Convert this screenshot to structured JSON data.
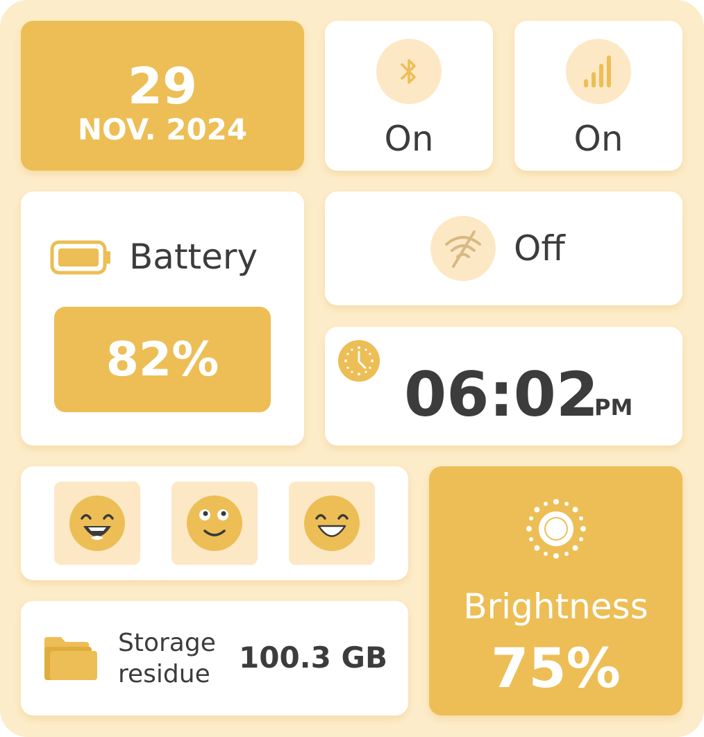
{
  "date": {
    "day": "29",
    "month_year": "NOV. 2024"
  },
  "bluetooth": {
    "icon": "bluetooth-icon",
    "status": "On"
  },
  "signal": {
    "icon": "signal-bars-icon",
    "status": "On"
  },
  "battery": {
    "icon": "battery-icon",
    "label": "Battery",
    "percent": "82%"
  },
  "wifi": {
    "icon": "wifi-off-icon",
    "status": "Off"
  },
  "clock": {
    "icon": "clock-icon",
    "time": "06:02",
    "meridiem": "PM"
  },
  "emojis": [
    {
      "icon": "laughing-face-icon"
    },
    {
      "icon": "smiling-face-icon"
    },
    {
      "icon": "grinning-face-icon"
    }
  ],
  "brightness": {
    "icon": "sun-icon",
    "label": "Brightness",
    "percent": "75%"
  },
  "storage": {
    "icon": "folder-icon",
    "label_line1": "Storage",
    "label_line2": "residue",
    "value": "100.3 GB"
  },
  "colors": {
    "accent": "#ecbe55",
    "background": "#fdecc9",
    "text": "#3c3c3c",
    "soft": "#fde8c6"
  }
}
